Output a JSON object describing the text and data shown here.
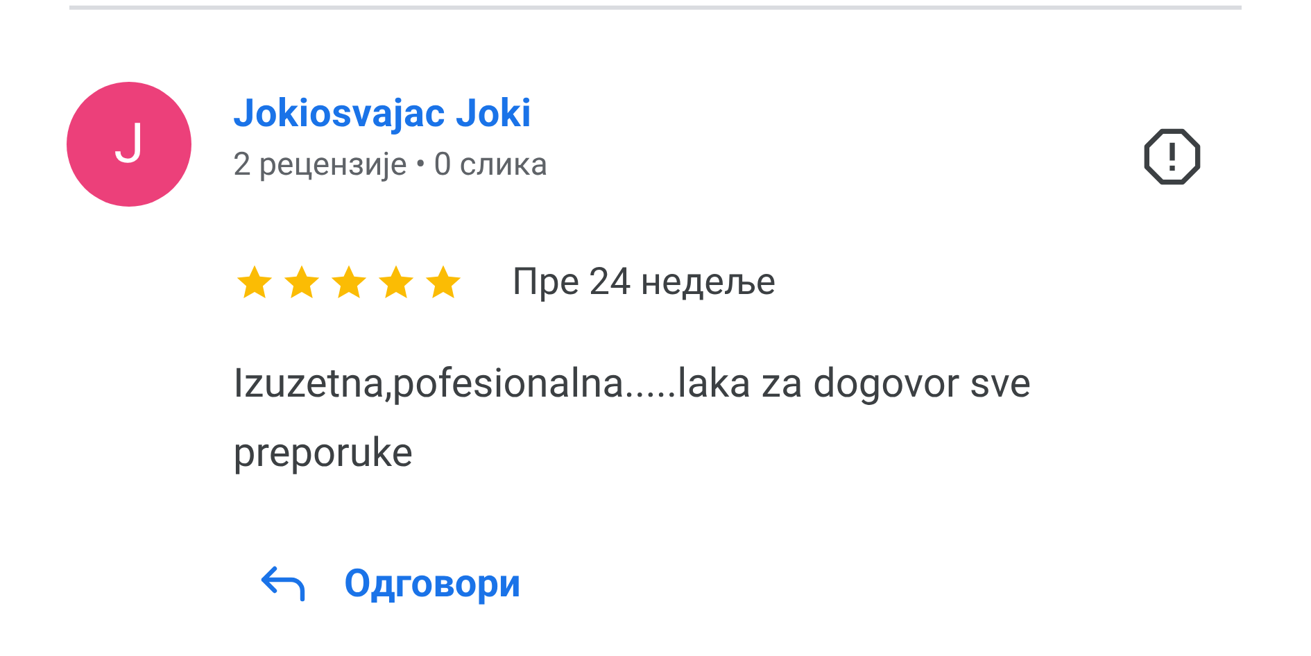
{
  "review": {
    "avatar": {
      "letter": "J",
      "color": "#ec407a"
    },
    "author": "Jokiosvajac Joki",
    "author_meta": "2 рецензије • 0 слика",
    "stars": 5,
    "date": "Пре 24 недеље",
    "text": "Izuzetna,pofesionalna.....laka za dogovor sve preporuke",
    "reply_button": "Одговори"
  }
}
